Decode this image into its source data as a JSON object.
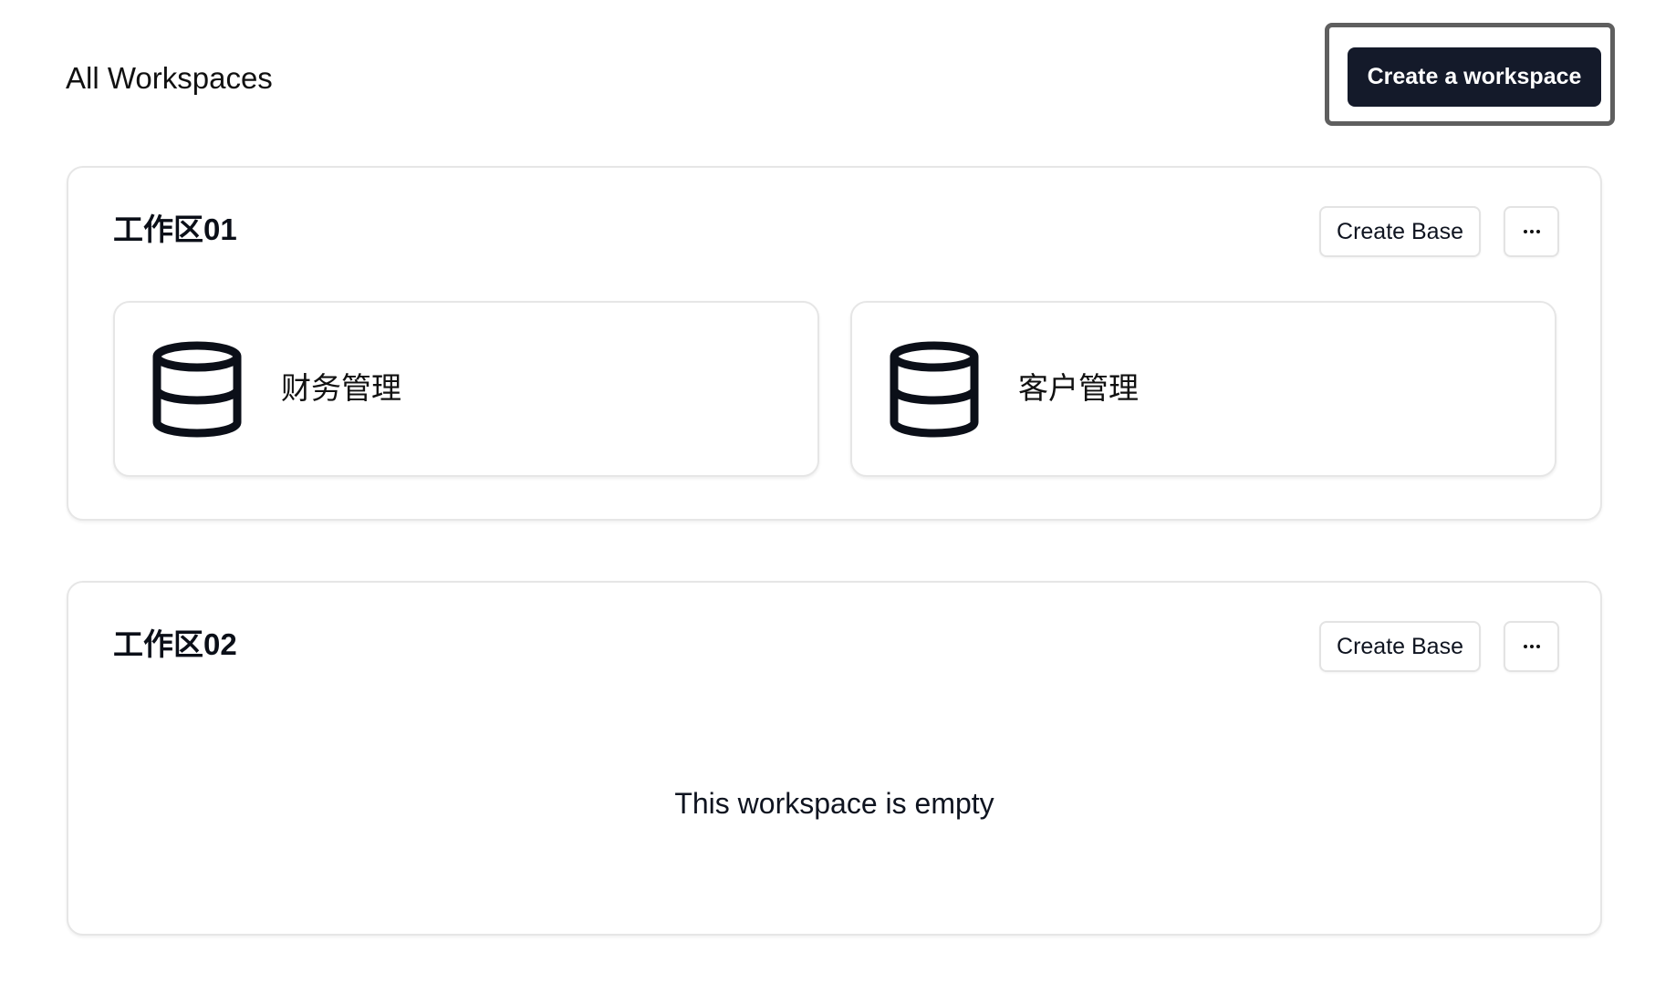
{
  "header": {
    "title": "All Workspaces",
    "create_workspace_label": "Create a workspace"
  },
  "workspaces": [
    {
      "name": "工作区01",
      "create_base_label": "Create Base",
      "more_icon": "more-horizontal-icon",
      "bases": [
        {
          "name": "财务管理",
          "icon": "database-icon"
        },
        {
          "name": "客户管理",
          "icon": "database-icon"
        }
      ]
    },
    {
      "name": "工作区02",
      "create_base_label": "Create Base",
      "more_icon": "more-horizontal-icon",
      "empty_message": "This workspace is empty",
      "bases": []
    }
  ],
  "colors": {
    "primary_button_bg": "#141a2a",
    "primary_button_text": "#ffffff",
    "highlight_frame": "#5f5f5f",
    "card_border": "#e6e6e6"
  }
}
